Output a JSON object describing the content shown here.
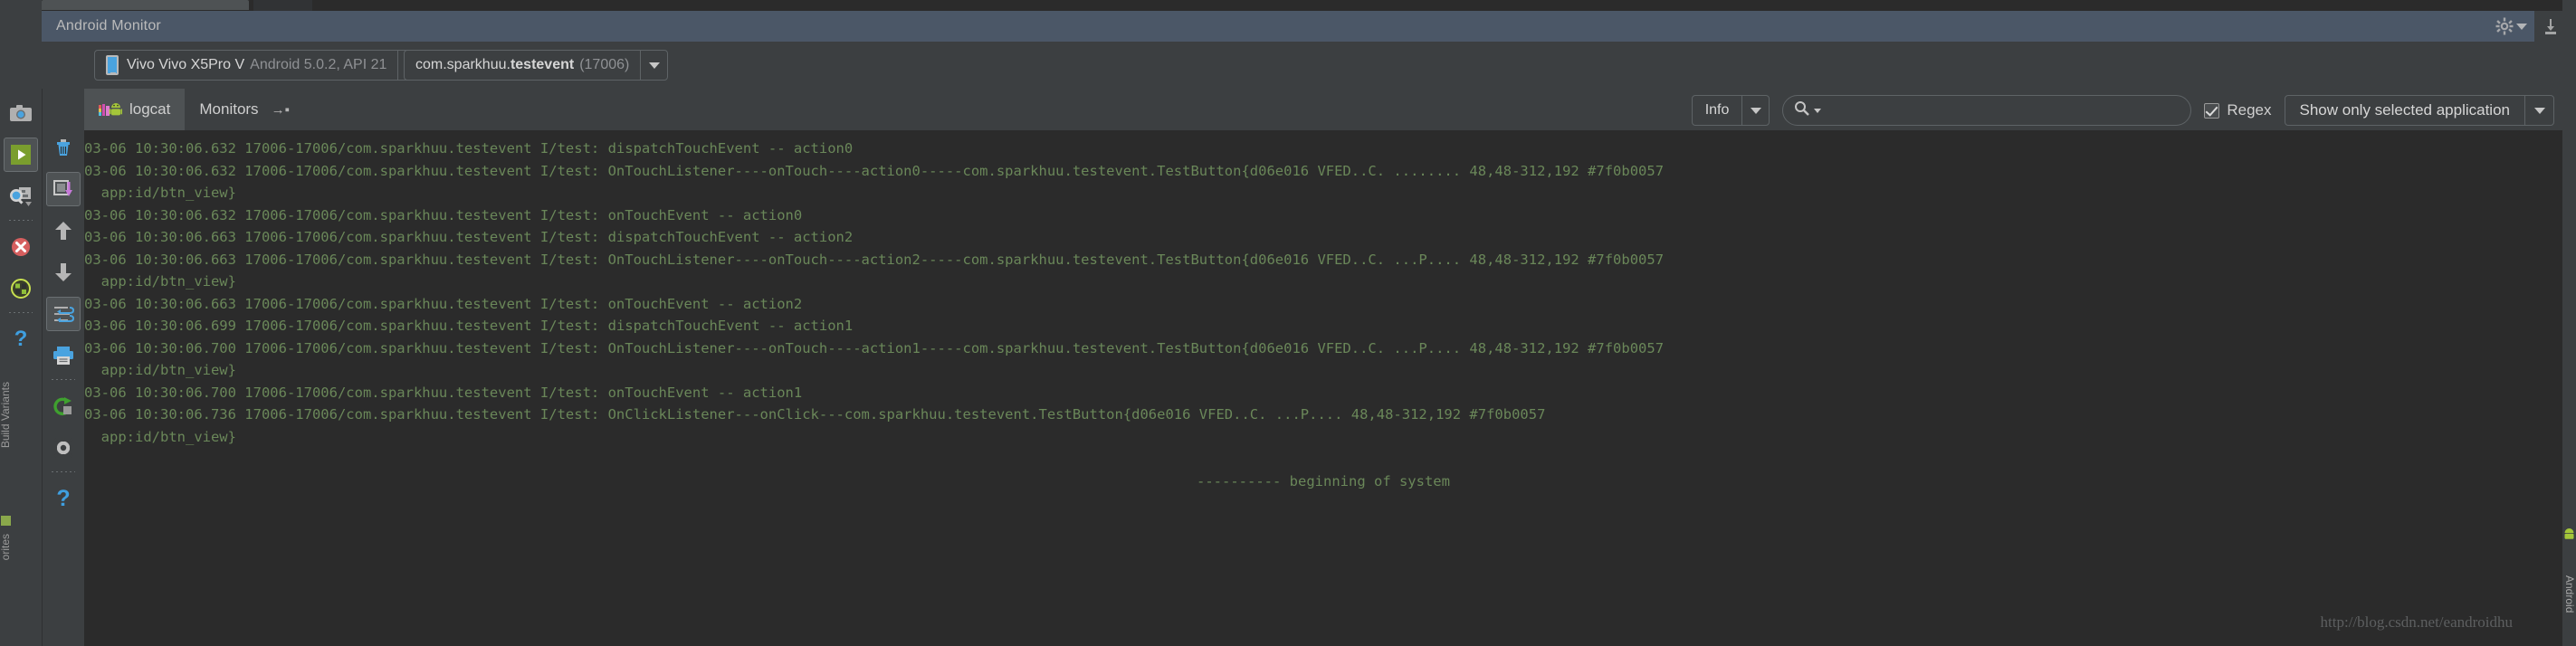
{
  "window": {
    "title": "Android Monitor",
    "actions": [
      {
        "name": "settings-gear",
        "icon": "gear-icon"
      },
      {
        "name": "hide-window",
        "icon": "minimize-icon"
      }
    ]
  },
  "toolbar": {
    "device": {
      "name": "Vivo Vivo X5Pro V",
      "detail": "Android 5.0.2, API 21",
      "icon": "phone-icon"
    },
    "process": {
      "package_prefix": "com.sparkhuu.",
      "package_bold": "testevent",
      "pid": "(17006)"
    }
  },
  "left_rail": {
    "items": [
      {
        "name": "screenshot-icon",
        "label": "Screen Capture",
        "selected": false
      },
      {
        "name": "screen-record-icon",
        "label": "Screen Record",
        "selected": true
      },
      {
        "name": "layout-inspector-icon",
        "label": "Layout Inspector",
        "selected": false
      },
      {
        "name": "terminate-icon",
        "label": "Terminate Application",
        "selected": false
      },
      {
        "name": "system-info-icon",
        "label": "System Information",
        "selected": false
      },
      {
        "name": "help-icon",
        "label": "Help",
        "selected": false
      }
    ]
  },
  "log_rail": {
    "items": [
      {
        "name": "clear-logcat-icon",
        "label": "Clear logcat",
        "selected": false
      },
      {
        "name": "scroll-to-end-icon",
        "label": "Scroll to the end",
        "selected": true
      },
      {
        "name": "up-icon",
        "label": "Up the stack trace",
        "selected": false
      },
      {
        "name": "down-icon",
        "label": "Down the stack trace",
        "selected": false
      },
      {
        "name": "soft-wrap-icon",
        "label": "Use Soft Wraps",
        "selected": true
      },
      {
        "name": "print-icon",
        "label": "Print",
        "selected": false
      },
      {
        "name": "restart-icon",
        "label": "Restart",
        "selected": false
      },
      {
        "name": "settings-icon",
        "label": "Logcat Settings",
        "selected": false
      },
      {
        "name": "help-icon",
        "label": "Help",
        "selected": false
      }
    ]
  },
  "tabs": [
    {
      "label": "logcat",
      "icon": "android-logcat-icon",
      "active": true
    },
    {
      "label": "Monitors",
      "icon": "arrow-expand-icon",
      "active": false
    }
  ],
  "filters": {
    "level": "Info",
    "search": {
      "value": "",
      "placeholder": "",
      "icon": "search-icon"
    },
    "regex": {
      "label": "Regex",
      "checked": true
    },
    "scope": "Show only selected application"
  },
  "log": {
    "lines": [
      {
        "text": "03-06 10:30:06.632 17006-17006/com.sparkhuu.testevent I/test: dispatchTouchEvent -- action0",
        "type": "entry"
      },
      {
        "text": "03-06 10:30:06.632 17006-17006/com.sparkhuu.testevent I/test: OnTouchListener----onTouch----action0-----com.sparkhuu.testevent.TestButton{d06e016 VFED..C. ........ 48,48-312,192 #7f0b0057",
        "type": "entry"
      },
      {
        "text": "  app:id/btn_view}",
        "type": "continuation"
      },
      {
        "text": "03-06 10:30:06.632 17006-17006/com.sparkhuu.testevent I/test: onTouchEvent -- action0",
        "type": "entry"
      },
      {
        "text": "03-06 10:30:06.663 17006-17006/com.sparkhuu.testevent I/test: dispatchTouchEvent -- action2",
        "type": "entry"
      },
      {
        "text": "03-06 10:30:06.663 17006-17006/com.sparkhuu.testevent I/test: OnTouchListener----onTouch----action2-----com.sparkhuu.testevent.TestButton{d06e016 VFED..C. ...P.... 48,48-312,192 #7f0b0057",
        "type": "entry"
      },
      {
        "text": "  app:id/btn_view}",
        "type": "continuation"
      },
      {
        "text": "03-06 10:30:06.663 17006-17006/com.sparkhuu.testevent I/test: onTouchEvent -- action2",
        "type": "entry"
      },
      {
        "text": "03-06 10:30:06.699 17006-17006/com.sparkhuu.testevent I/test: dispatchTouchEvent -- action1",
        "type": "entry"
      },
      {
        "text": "03-06 10:30:06.700 17006-17006/com.sparkhuu.testevent I/test: OnTouchListener----onTouch----action1-----com.sparkhuu.testevent.TestButton{d06e016 VFED..C. ...P.... 48,48-312,192 #7f0b0057",
        "type": "entry"
      },
      {
        "text": "  app:id/btn_view}",
        "type": "continuation"
      },
      {
        "text": "03-06 10:30:06.700 17006-17006/com.sparkhuu.testevent I/test: onTouchEvent -- action1",
        "type": "entry"
      },
      {
        "text": "03-06 10:30:06.736 17006-17006/com.sparkhuu.testevent I/test: OnClickListener---onClick---com.sparkhuu.testevent.TestButton{d06e016 VFED..C. ...P.... 48,48-312,192 #7f0b0057",
        "type": "entry"
      },
      {
        "text": "  app:id/btn_view}",
        "type": "continuation"
      },
      {
        "text": "",
        "type": "blank"
      },
      {
        "text": "---------- beginning of system",
        "type": "system"
      }
    ]
  },
  "side_labels": {
    "build_variants": "Build Variants",
    "favorites": "orites",
    "android_monitor": "Android"
  },
  "watermark": "http://blog.csdn.net/eandroidhu",
  "colors": {
    "log_text": "#6a8759",
    "log_bg": "#2b2b2b",
    "panel_bg": "#3c3f41",
    "title_bg": "#4b5767",
    "accent_green": "#8aa84b"
  }
}
